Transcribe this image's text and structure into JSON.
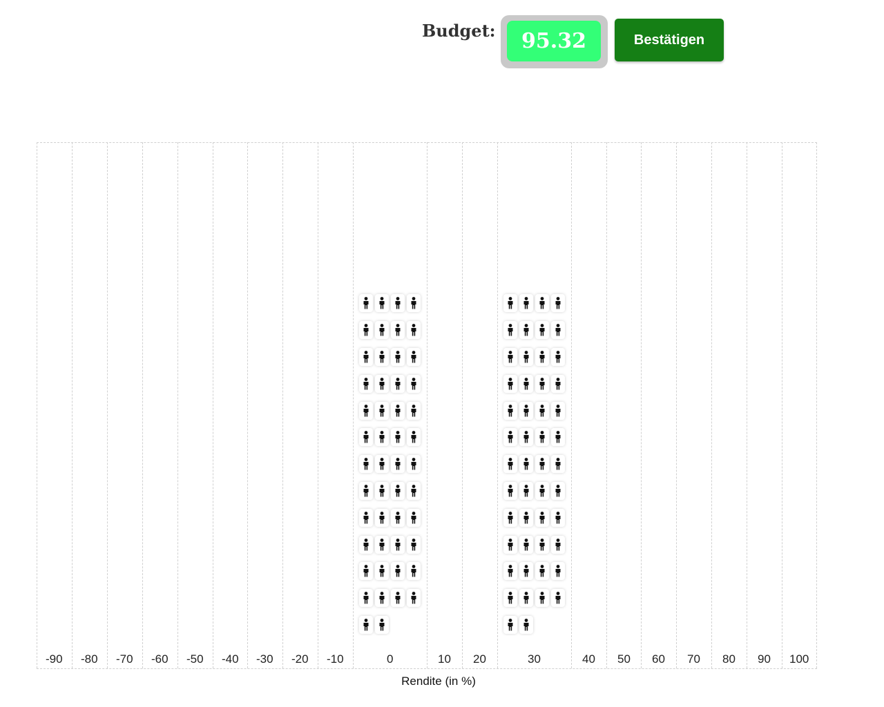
{
  "header": {
    "budget_label": "Budget:",
    "budget_value": "95.32",
    "confirm_label": "Bestätigen"
  },
  "colors": {
    "budget_bg": "#33ff77",
    "confirm_bg": "#157f15",
    "icon": "#111111"
  },
  "chart_data": {
    "type": "table",
    "xlabel": "Rendite (in %)",
    "ylabel": "",
    "categories": [
      "-90",
      "-80",
      "-70",
      "-60",
      "-50",
      "-40",
      "-30",
      "-20",
      "-10",
      "0",
      "10",
      "20",
      "30",
      "40",
      "50",
      "60",
      "70",
      "80",
      "90",
      "100"
    ],
    "values": [
      0,
      0,
      0,
      0,
      0,
      0,
      0,
      0,
      0,
      50,
      0,
      0,
      50,
      0,
      0,
      0,
      0,
      0,
      0,
      0
    ],
    "icon": "person-icon",
    "icons_per_row": 4,
    "grid": true
  }
}
